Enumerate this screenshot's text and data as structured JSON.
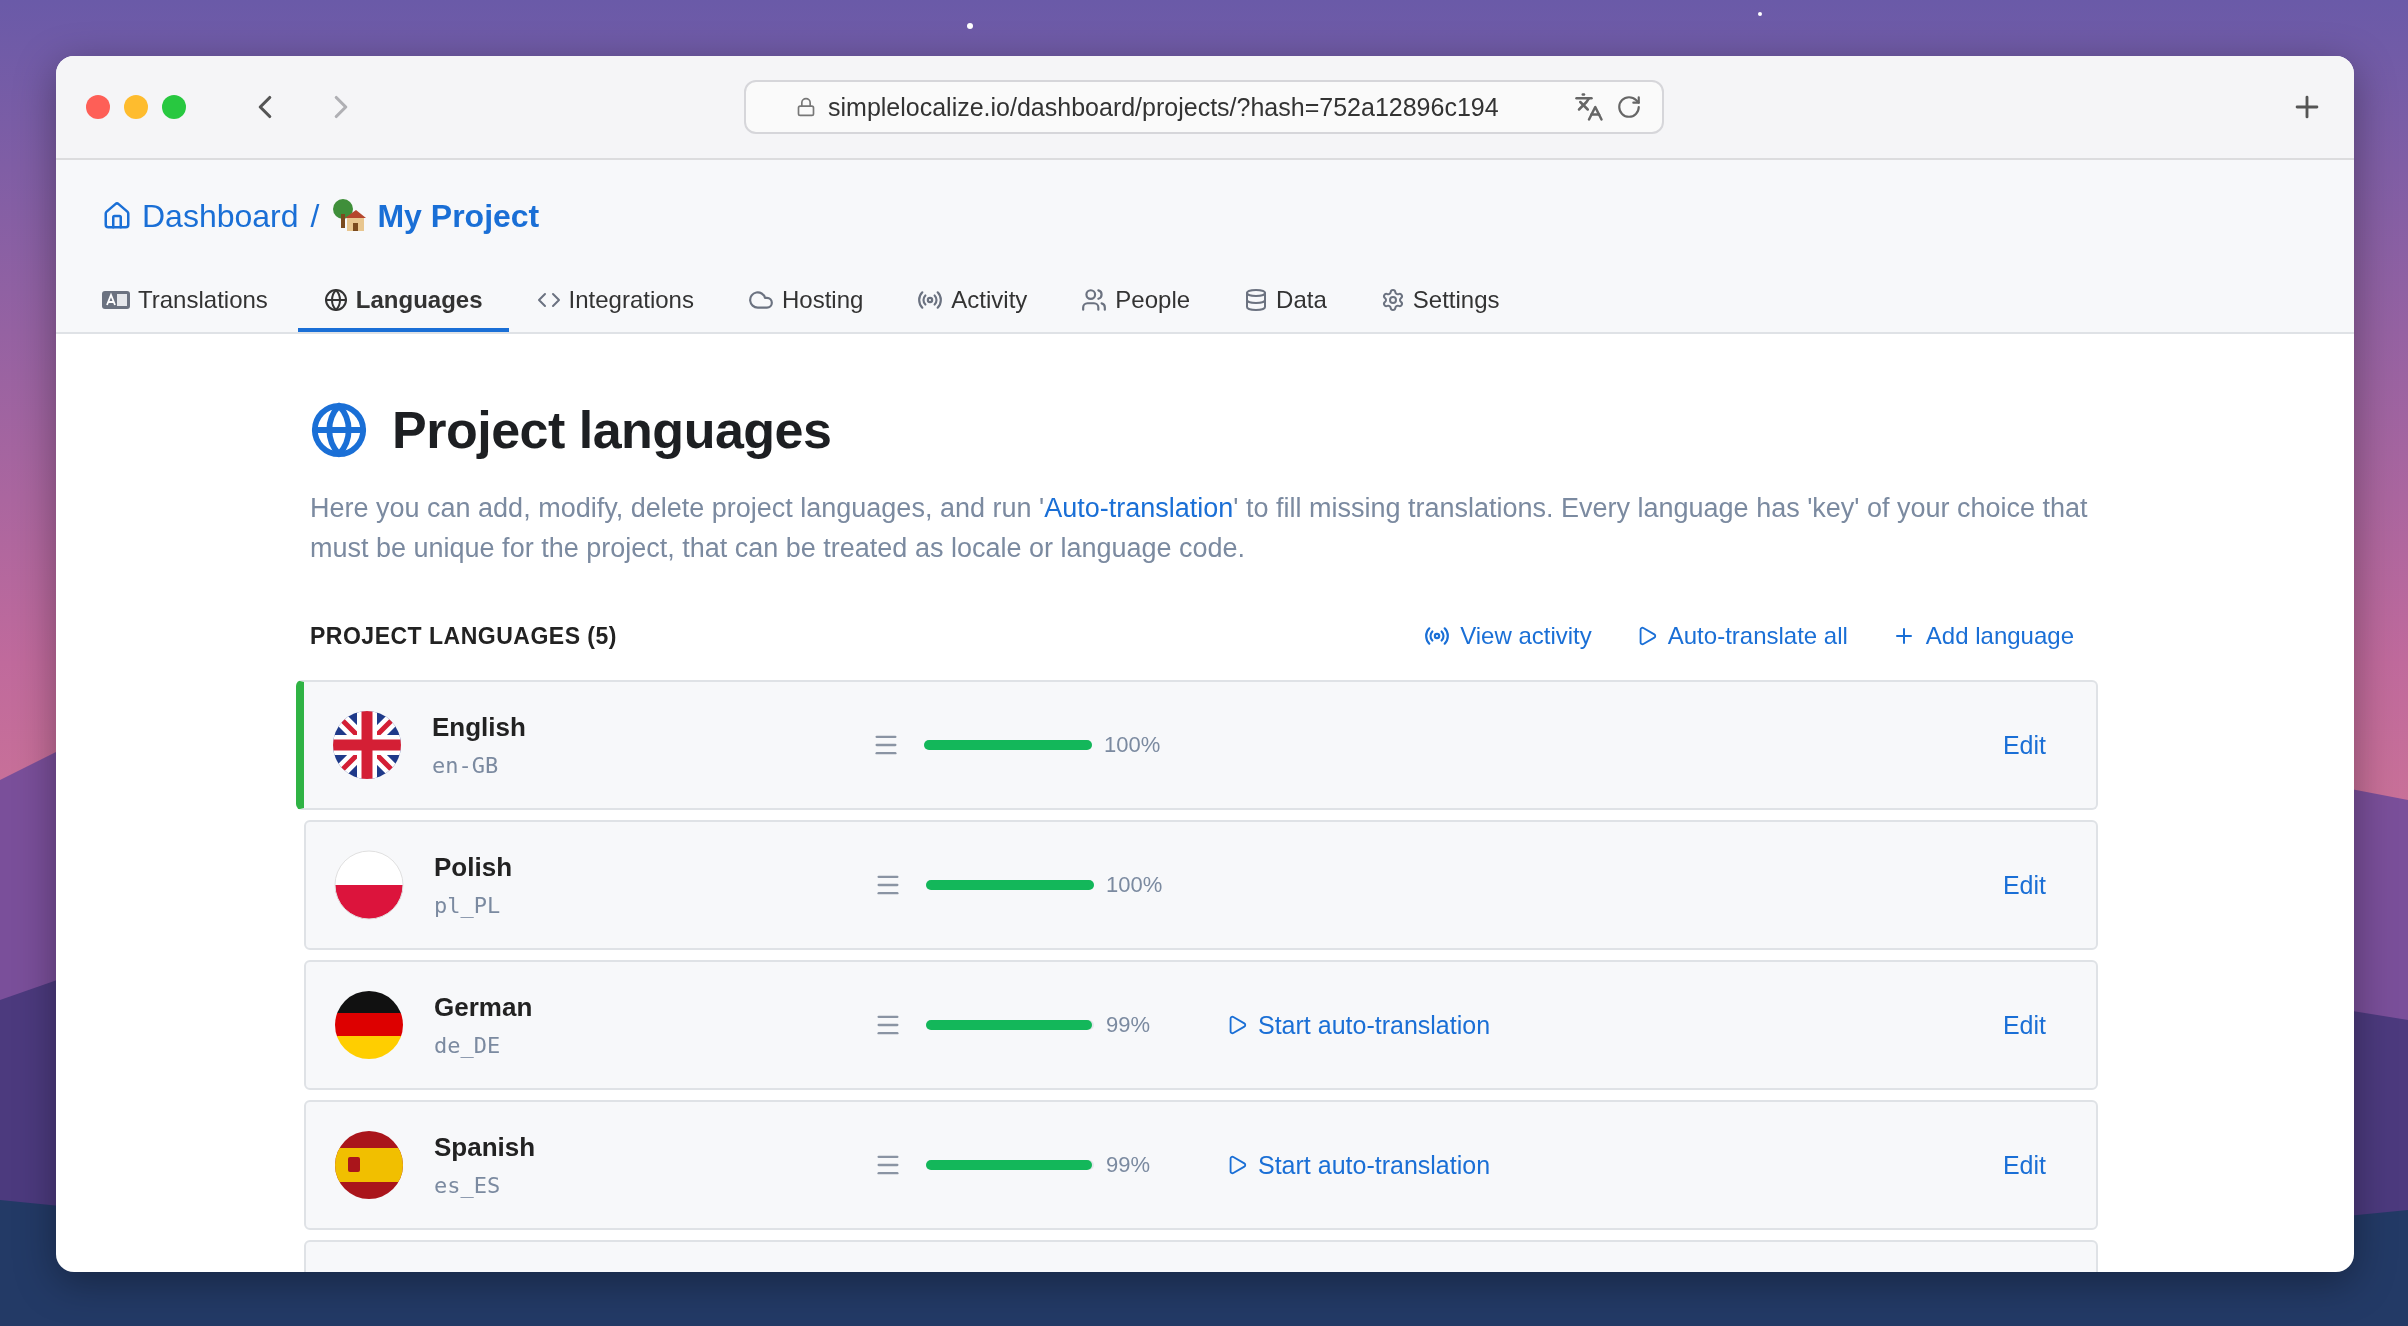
{
  "browser": {
    "url": "simplelocalize.io/dashboard/projects/?hash=752a12896c194"
  },
  "breadcrumb": [
    {
      "label": "Dashboard"
    },
    {
      "label": "My Project"
    }
  ],
  "breadcrumb_separator": "/",
  "tabs": [
    {
      "label": "Translations",
      "selected": false
    },
    {
      "label": "Languages",
      "selected": true
    },
    {
      "label": "Integrations",
      "selected": false
    },
    {
      "label": "Hosting",
      "selected": false
    },
    {
      "label": "Activity",
      "selected": false
    },
    {
      "label": "People",
      "selected": false
    },
    {
      "label": "Data",
      "selected": false
    },
    {
      "label": "Settings",
      "selected": false
    }
  ],
  "page": {
    "title": "Project languages",
    "description": {
      "before": "Here you can add, modify, delete project languages, and run '",
      "link": "Auto-translation",
      "after": "' to fill missing translations. Every language has 'key' of your choice that must be unique for the project, that can be treated as locale or language code."
    }
  },
  "section": {
    "heading": "PROJECT LANGUAGES (5)",
    "actions": [
      {
        "kind": "activity",
        "label": "View activity"
      },
      {
        "kind": "play",
        "label": "Auto-translate all"
      },
      {
        "kind": "add",
        "label": "Add language"
      }
    ]
  },
  "languages": [
    {
      "name": "English",
      "key": "en-GB",
      "default": true,
      "level": 1,
      "percent": "100%",
      "edit": "Edit"
    },
    {
      "name": "Polish",
      "key": "pl_PL",
      "default": false,
      "level": 1,
      "percent": "100%",
      "edit": "Edit"
    },
    {
      "name": "German",
      "key": "de_DE",
      "default": false,
      "level": 0.99,
      "percent": "99%",
      "auto_translate": "Start auto-translation",
      "edit": "Edit"
    },
    {
      "name": "Spanish",
      "key": "es_ES",
      "default": false,
      "level": 0.99,
      "percent": "99%",
      "auto_translate": "Start auto-translation",
      "edit": "Edit"
    }
  ]
}
